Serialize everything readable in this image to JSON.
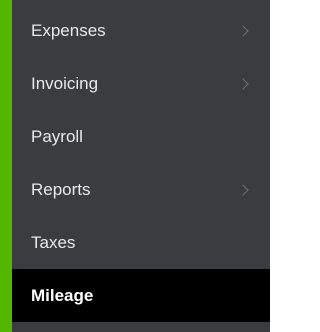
{
  "sidebar": {
    "accent_color": "#53b700",
    "background_color": "#3a3c40",
    "active_background_color": "#000000",
    "items": [
      {
        "label": "Expenses",
        "has_submenu": true,
        "icon": "chevron-right-icon"
      },
      {
        "label": "Invoicing",
        "has_submenu": true,
        "icon": "chevron-right-icon"
      },
      {
        "label": "Payroll",
        "has_submenu": false
      },
      {
        "label": "Reports",
        "has_submenu": true,
        "icon": "chevron-right-icon"
      },
      {
        "label": "Taxes",
        "has_submenu": false
      },
      {
        "label": "Mileage",
        "has_submenu": false,
        "active": true
      }
    ]
  }
}
